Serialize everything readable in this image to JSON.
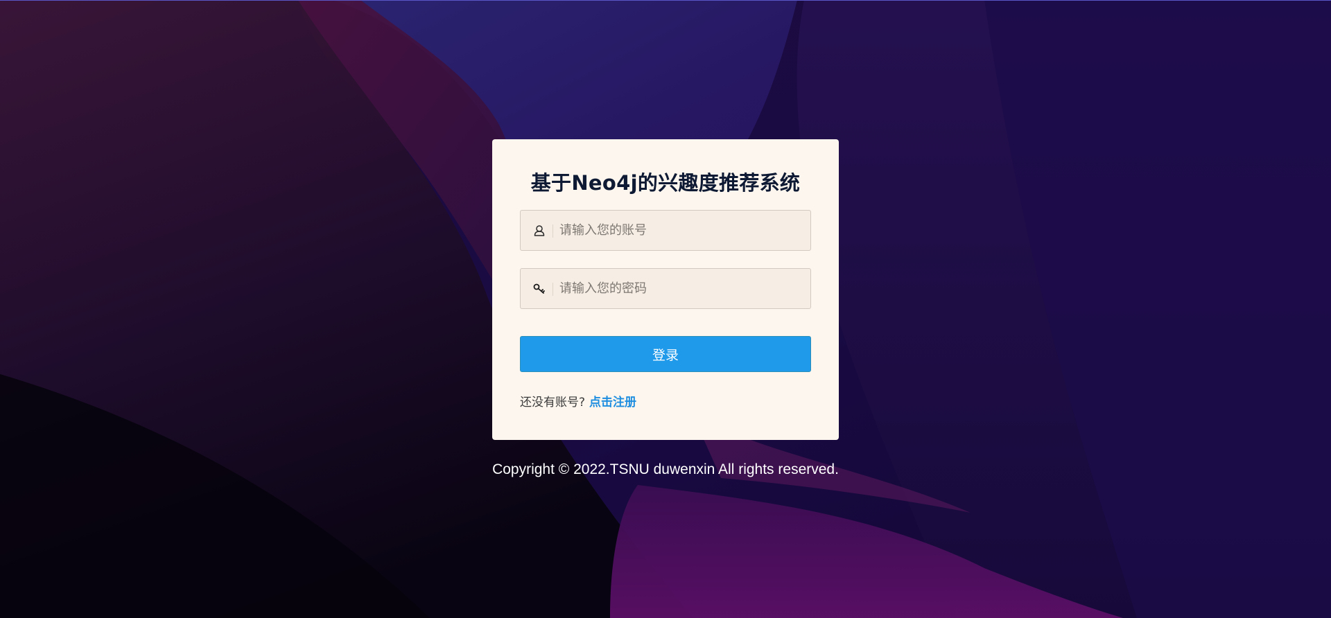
{
  "page": {
    "title": "基于Neo4j的兴趣度推荐系统"
  },
  "login": {
    "username_placeholder": "请输入您的账号",
    "password_placeholder": "请输入您的密码",
    "username_value": "",
    "password_value": "",
    "submit_label": "登录",
    "register_prompt": "还没有账号?",
    "register_link": "点击注册"
  },
  "icons": {
    "username": "user-icon",
    "password": "key-icon"
  },
  "footer": {
    "copyright": "Copyright © 2022.TSNU duwenxin All rights reserved."
  },
  "colors": {
    "card_background": "#fdf6ee",
    "primary_button": "#1f9aeb",
    "link": "#1d8de0",
    "title": "#0e1a33",
    "page_background": "#14082e"
  }
}
